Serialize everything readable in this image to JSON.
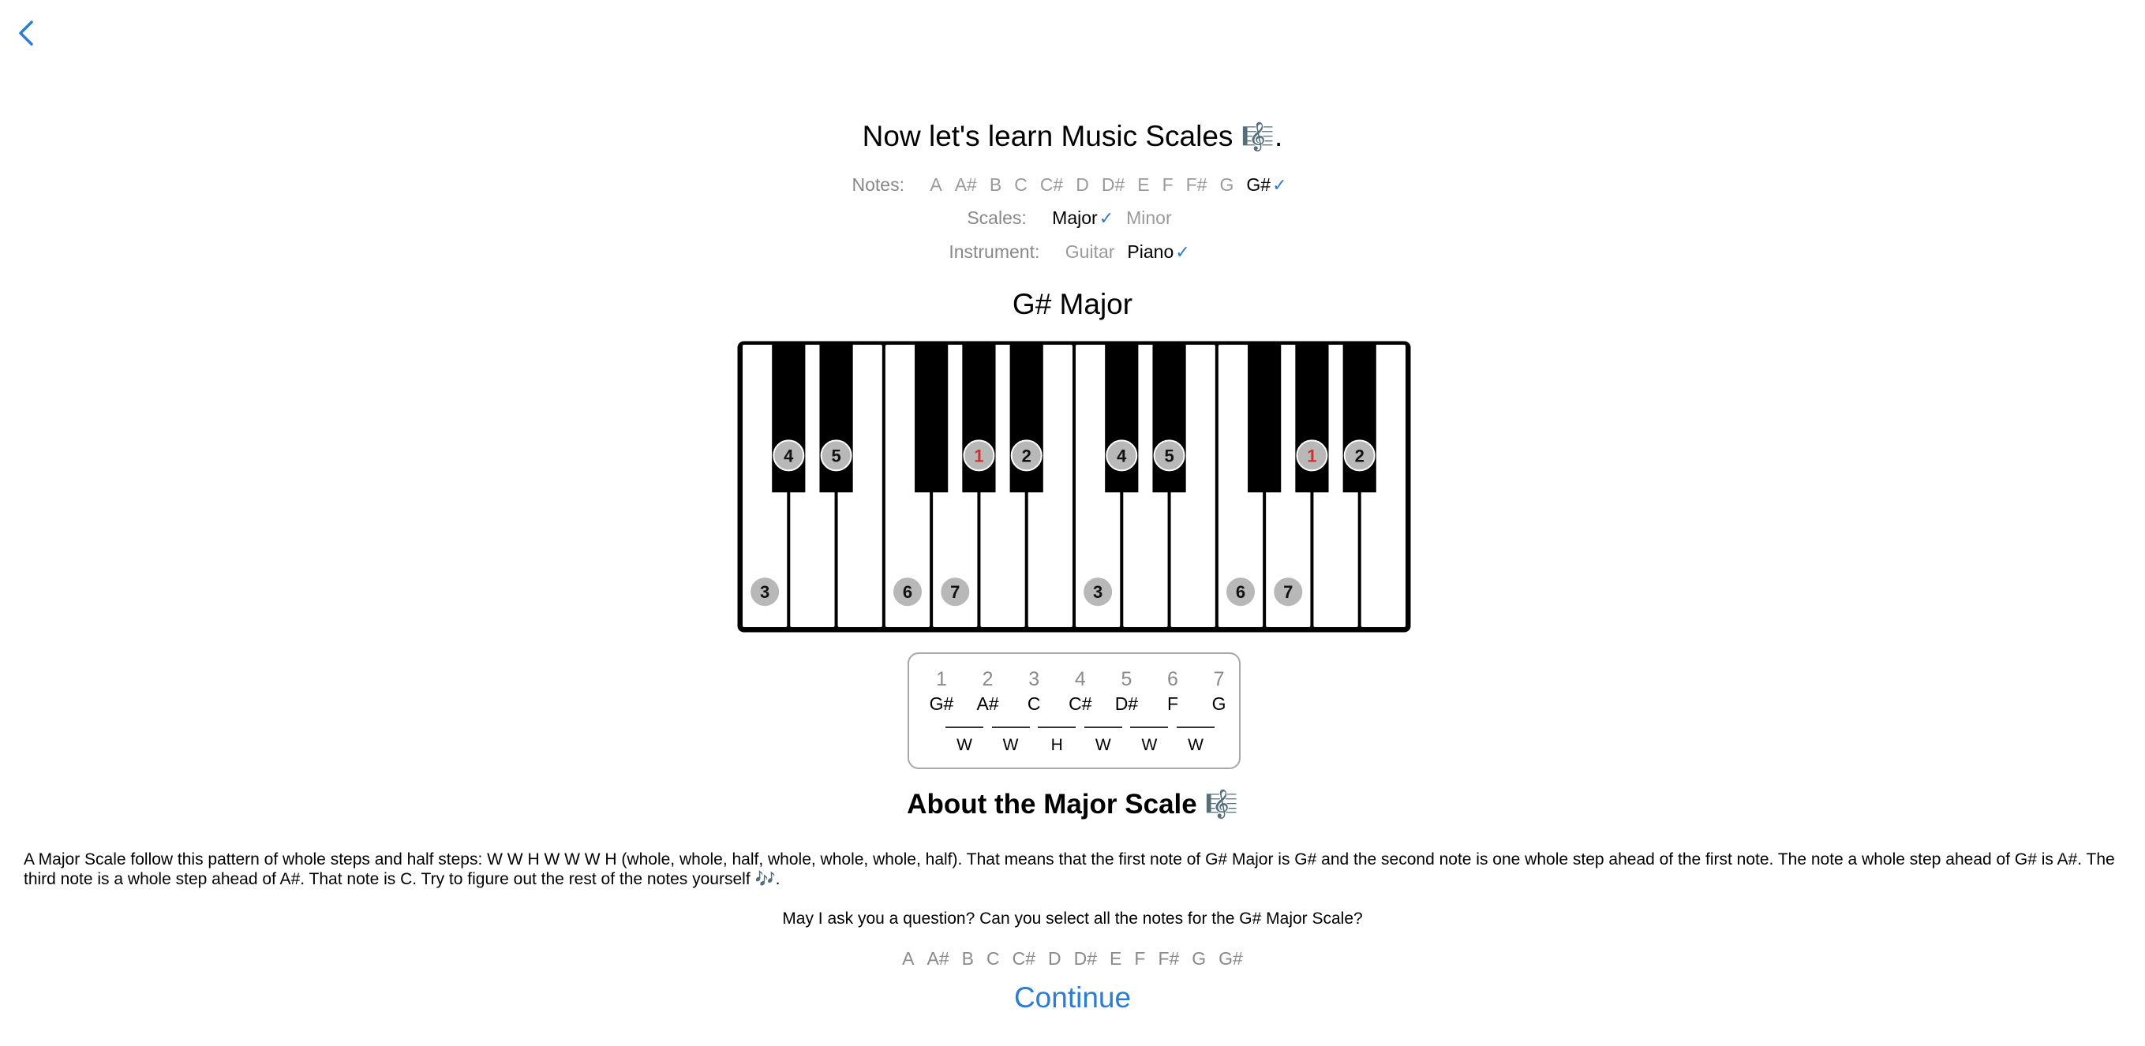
{
  "title": "Now let's learn Music Scales",
  "title_icon": "🎼",
  "title_suffix": ".",
  "notes_filter": {
    "label": "Notes:",
    "options": [
      "A",
      "A#",
      "B",
      "C",
      "C#",
      "D",
      "D#",
      "E",
      "F",
      "F#",
      "G",
      "G#"
    ],
    "selected": "G#"
  },
  "scales_filter": {
    "label": "Scales:",
    "options": [
      "Major",
      "Minor"
    ],
    "selected": "Major"
  },
  "instrument_filter": {
    "label": "Instrument:",
    "options": [
      "Guitar",
      "Piano"
    ],
    "selected": "Piano"
  },
  "check_mark": "✓",
  "scale_name": "G# Major",
  "piano": {
    "white_key_count": 14,
    "black_keys_after_white": [
      0,
      1,
      3,
      4,
      5,
      7,
      8,
      10,
      11,
      12
    ],
    "white_markers": [
      {
        "key": 0,
        "label": "3",
        "root": false
      },
      {
        "key": 3,
        "label": "6",
        "root": false
      },
      {
        "key": 4,
        "label": "7",
        "root": false
      },
      {
        "key": 7,
        "label": "3",
        "root": false
      },
      {
        "key": 10,
        "label": "6",
        "root": false
      },
      {
        "key": 11,
        "label": "7",
        "root": false
      }
    ],
    "black_markers": [
      {
        "after": 0,
        "label": "4",
        "root": false
      },
      {
        "after": 1,
        "label": "5",
        "root": false
      },
      {
        "after": 4,
        "label": "1",
        "root": true
      },
      {
        "after": 5,
        "label": "2",
        "root": false
      },
      {
        "after": 7,
        "label": "4",
        "root": false
      },
      {
        "after": 8,
        "label": "5",
        "root": false
      },
      {
        "after": 11,
        "label": "1",
        "root": true
      },
      {
        "after": 12,
        "label": "2",
        "root": false
      }
    ],
    "root_color": "#d0312d",
    "marker_color": "#b8b8b8"
  },
  "steps": {
    "numbers": [
      "1",
      "2",
      "3",
      "4",
      "5",
      "6",
      "7"
    ],
    "notes": [
      "G#",
      "A#",
      "C",
      "C#",
      "D#",
      "F",
      "G"
    ],
    "intervals": [
      "W",
      "W",
      "H",
      "W",
      "W",
      "W"
    ]
  },
  "about_title": "About the Major Scale",
  "about_icon": "🎼",
  "paragraph": "A Major Scale follow this pattern of whole steps and half steps: W W H W W W H (whole, whole, half, whole, whole, whole, half). That means that the first note of G# Major is G# and the second note is one whole step ahead of the first note. The note a whole step ahead of G# is A#. The third note is a whole step ahead of A#. That note is C. Try to figure out the rest of the notes yourself 🎶.",
  "question": "May I ask you a question? Can you select all the notes for the G# Major Scale?",
  "answer_options": [
    "A",
    "A#",
    "B",
    "C",
    "C#",
    "D",
    "D#",
    "E",
    "F",
    "F#",
    "G",
    "G#"
  ],
  "continue_label": "Continue",
  "colors": {
    "accent": "#2a7cd4",
    "muted": "#8a8a8a"
  }
}
